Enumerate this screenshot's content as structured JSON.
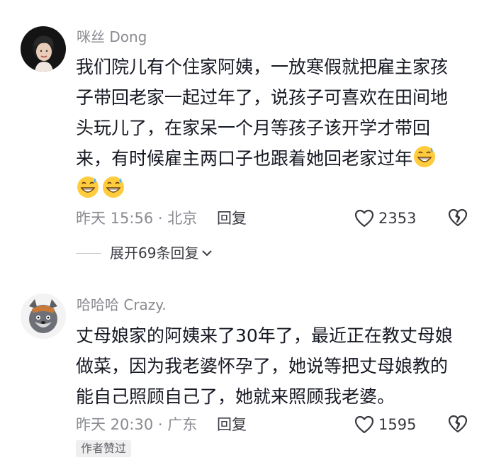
{
  "comments": [
    {
      "username": "咪丝 Dong",
      "text_lines": [
        "我们院儿有个住家阿姨，一放寒假就把雇主家孩",
        "子带回老家一起过年了，说孩子可喜欢在田间地",
        "头玩儿了，在家呆一个月等孩子该开学才带回",
        "来，有时候雇主两口子也跟着她回老家过年"
      ],
      "emoji": "grin-sweat-emoji",
      "time": "昨天 15:56 · 北京",
      "reply_label": "回复",
      "like_count": "2353",
      "expand_label": "展开69条回复"
    },
    {
      "username": "哈哈哈 Crazy.",
      "text_lines": [
        "丈母娘家的阿姨来了30年了，最近正在教丈母娘",
        "做菜，因为我老婆怀孕了，她说等把丈母娘教的",
        "能自己照顾自己了，她就来照顾我老婆。"
      ],
      "time": "昨天 20:30 · 广东",
      "reply_label": "回复",
      "like_count": "1595",
      "author_badge": "作者赞过"
    }
  ],
  "colors": {
    "primary_text": "#161823",
    "secondary_text": "#8a8b91",
    "badge_bg": "#efefef"
  }
}
